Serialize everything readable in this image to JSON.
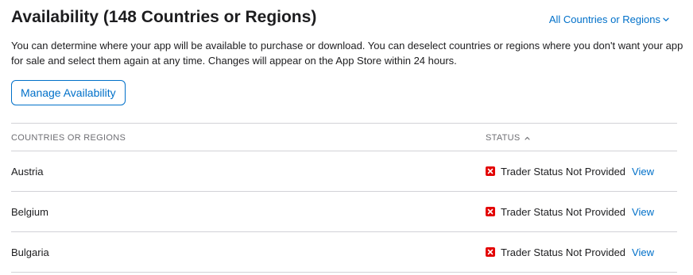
{
  "header": {
    "title": "Availability (148 Countries or Regions)",
    "filter_label": "All Countries or Regions"
  },
  "description": "You can determine where your app will be available to purchase or download. You can deselect countries or regions where you don't want your app for sale and select them again at any time. Changes will appear on the App Store within 24 hours.",
  "manage_button": "Manage Availability",
  "table": {
    "columns": {
      "country": "COUNTRIES OR REGIONS",
      "status": "STATUS"
    },
    "rows": [
      {
        "country": "Austria",
        "status": "Trader Status Not Provided",
        "action": "View"
      },
      {
        "country": "Belgium",
        "status": "Trader Status Not Provided",
        "action": "View"
      },
      {
        "country": "Bulgaria",
        "status": "Trader Status Not Provided",
        "action": "View"
      }
    ]
  },
  "colors": {
    "accent": "#0070c9",
    "status_error": "#e30000",
    "divider": "#d2d2d7"
  },
  "icons": {
    "filter": "chevron-down-icon",
    "sort": "chevron-up-icon",
    "status": "error-x-icon"
  }
}
